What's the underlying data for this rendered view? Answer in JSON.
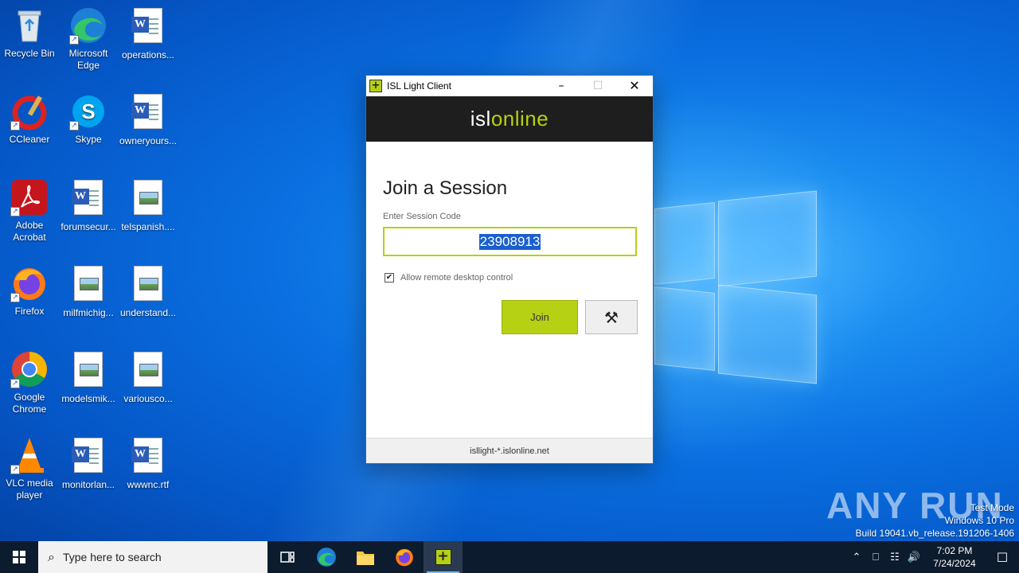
{
  "desktop": {
    "icons": [
      {
        "label": "Recycle Bin"
      },
      {
        "label": "Microsoft Edge"
      },
      {
        "label": "operations..."
      },
      {
        "label": "CCleaner"
      },
      {
        "label": "Skype"
      },
      {
        "label": "owneryours..."
      },
      {
        "label": "Adobe Acrobat"
      },
      {
        "label": "forumsecur..."
      },
      {
        "label": "telspanish...."
      },
      {
        "label": "Firefox"
      },
      {
        "label": "milfmichig..."
      },
      {
        "label": "understand..."
      },
      {
        "label": "Google Chrome"
      },
      {
        "label": "modelsmik..."
      },
      {
        "label": "variousco..."
      },
      {
        "label": "VLC media player"
      },
      {
        "label": "monitorlan..."
      },
      {
        "label": "wwwnc.rtf"
      }
    ]
  },
  "dialog": {
    "title": "ISL Light Client",
    "brand_isl": "isl",
    "brand_online": "online",
    "heading": "Join a Session",
    "code_label": "Enter Session Code",
    "session_code": "23908913",
    "allow_remote_label": "Allow remote desktop control",
    "allow_remote_checked": true,
    "join_label": "Join",
    "footer": "isllight-*.islonline.net"
  },
  "watermark": {
    "text": "ANY RUN",
    "test_mode": "Test Mode",
    "os": "Windows 10 Pro",
    "build": "Build 19041.vb_release.191206-1406"
  },
  "taskbar": {
    "search_placeholder": "Type here to search",
    "time": "7:02 PM",
    "date": "7/24/2024"
  },
  "colors": {
    "accent": "#b6d014",
    "brand_bar": "#1e1e1e",
    "selection": "#1a5fd0",
    "taskbar": "#0d1b2e"
  }
}
